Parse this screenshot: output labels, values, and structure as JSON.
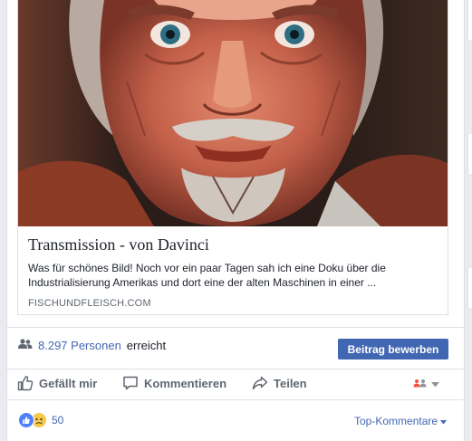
{
  "link_preview": {
    "title": "Transmission - von Davinci",
    "description": "Was für schönes Bild! Noch vor ein paar Tagen sah ich eine Doku über die Industrialisierung Amerikas und dort eine der alten Maschinen in einer ...",
    "domain": "FISCHUNDFLEISCH.COM"
  },
  "reach": {
    "count": "8.297 Personen",
    "label": "erreicht"
  },
  "promote_button": "Beitrag bewerben",
  "actions": {
    "like": "Gefällt mir",
    "comment": "Kommentieren",
    "share": "Teilen"
  },
  "reactions": {
    "count": "50",
    "types": [
      "like",
      "sad"
    ]
  },
  "comments_sort": "Top-Kommentare",
  "colors": {
    "brand": "#4267b2",
    "text_secondary": "#606770",
    "border": "#dddfe2"
  },
  "icons": [
    "people-icon",
    "like-thumb-icon",
    "comment-bubble-icon",
    "share-arrow-icon",
    "audience-friends-icon",
    "caret-down-icon",
    "like-reaction-icon",
    "sad-reaction-icon"
  ]
}
